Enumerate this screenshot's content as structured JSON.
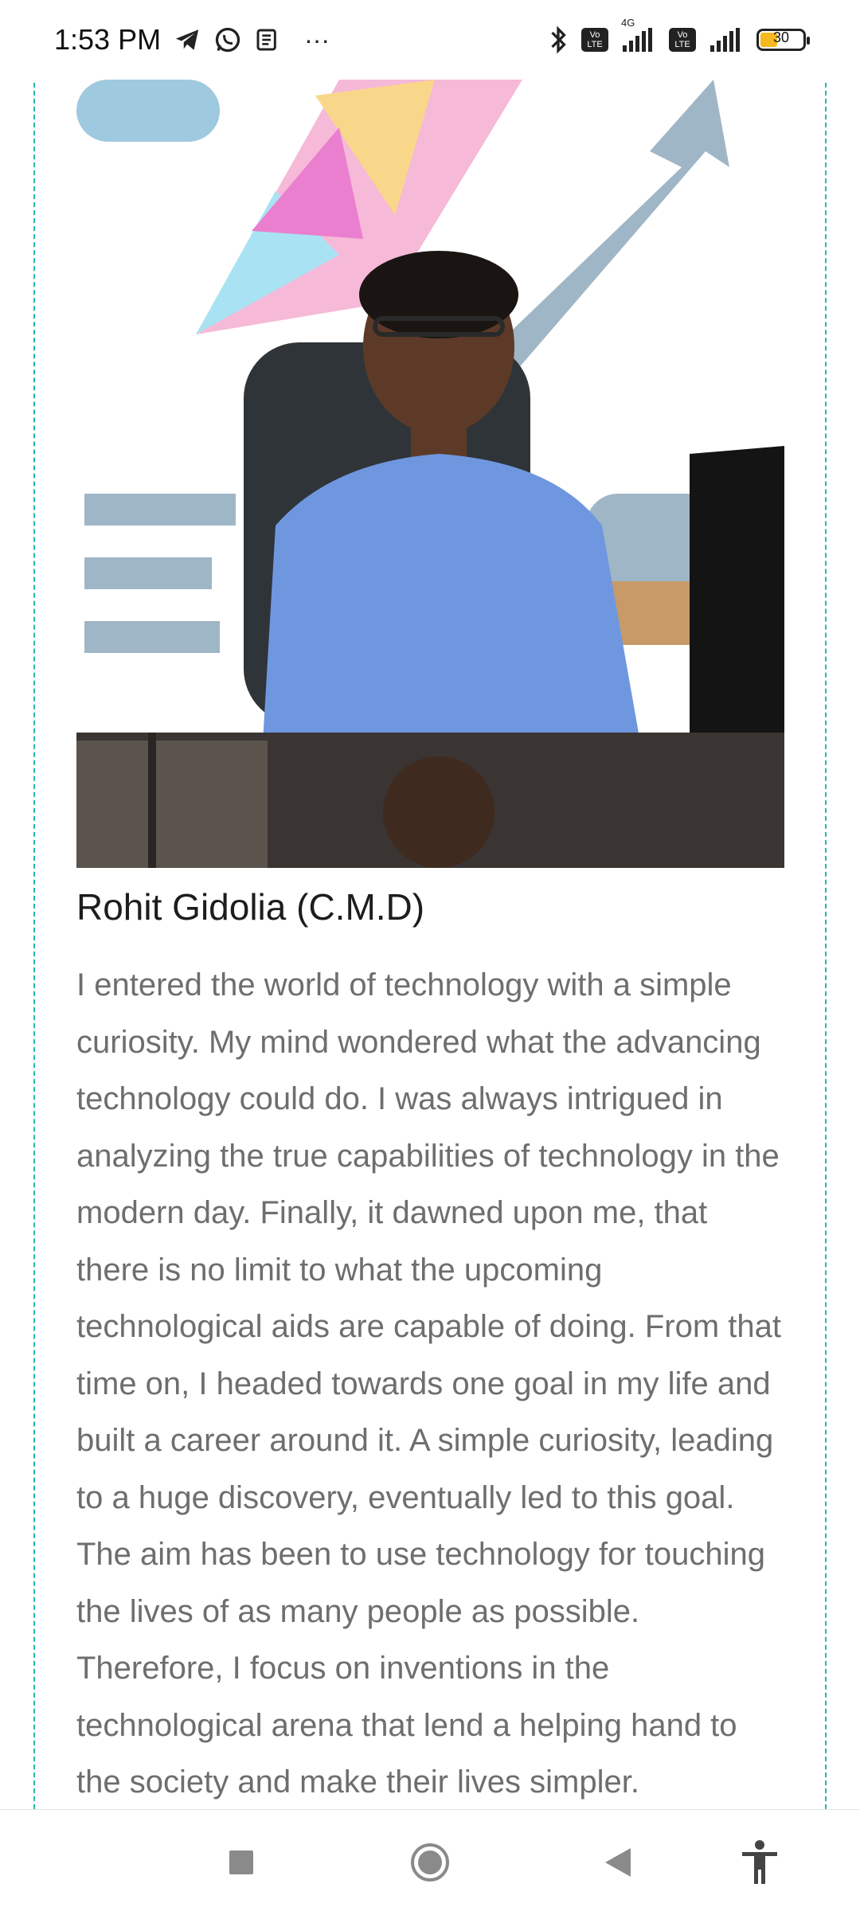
{
  "status_bar": {
    "time": "1:53 PM",
    "more": "···",
    "signal_labels": [
      "Vo LTE",
      "Vo LTE"
    ],
    "network": "4G",
    "battery_level": "30"
  },
  "profile": {
    "name": "Rohit Gidolia (C.M.D)",
    "bio": "I entered the world of technology with a simple curiosity. My mind wondered what the advancing technology could do. I was always intrigued in analyzing the true capabilities of technology in the modern day. Finally, it dawned upon me, that there is no limit to what the upcoming technological aids are capable of doing. From that time on, I headed towards one goal in my life and built a career around it. A simple curiosity, leading to a huge discovery, eventually led to this goal. The aim has been to use technology for touching the lives of as many people as possible. Therefore, I focus on inventions in the technological arena that lend a helping hand to the society and make their lives simpler."
  },
  "colors": {
    "accent_border": "#22b8b0",
    "body_text": "#6e6e6e",
    "heading_text": "#1d1d1d"
  },
  "icons": {
    "status": [
      "telegram-icon",
      "whatsapp-icon",
      "news-icon",
      "bluetooth-icon",
      "signal-icon",
      "battery-icon"
    ],
    "nav": [
      "recents-icon",
      "home-icon",
      "back-icon",
      "accessibility-icon"
    ]
  }
}
